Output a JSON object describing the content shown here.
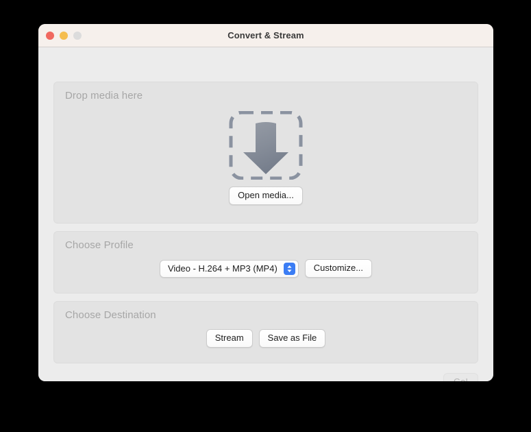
{
  "window": {
    "title": "Convert & Stream",
    "traffic_lights": [
      {
        "name": "close-button",
        "color": "#F0685F"
      },
      {
        "name": "minimize-button",
        "color": "#F5BD4F"
      },
      {
        "name": "zoom-button",
        "color": "#DCDCDC"
      }
    ]
  },
  "media_section": {
    "title": "Drop media here",
    "dropzone_icon": "download-arrow-icon",
    "open_media_label": "Open media..."
  },
  "profile_section": {
    "title": "Choose Profile",
    "selected_profile": "Video - H.264 + MP3 (MP4)",
    "popup_indicator_icon": "chevron-up-down-icon",
    "popup_indicator_color": "#3B7DF4",
    "customize_label": "Customize..."
  },
  "destination_section": {
    "title": "Choose Destination",
    "stream_label": "Stream",
    "save_as_file_label": "Save as File"
  },
  "footer": {
    "go_label": "Go!",
    "go_enabled": false
  }
}
